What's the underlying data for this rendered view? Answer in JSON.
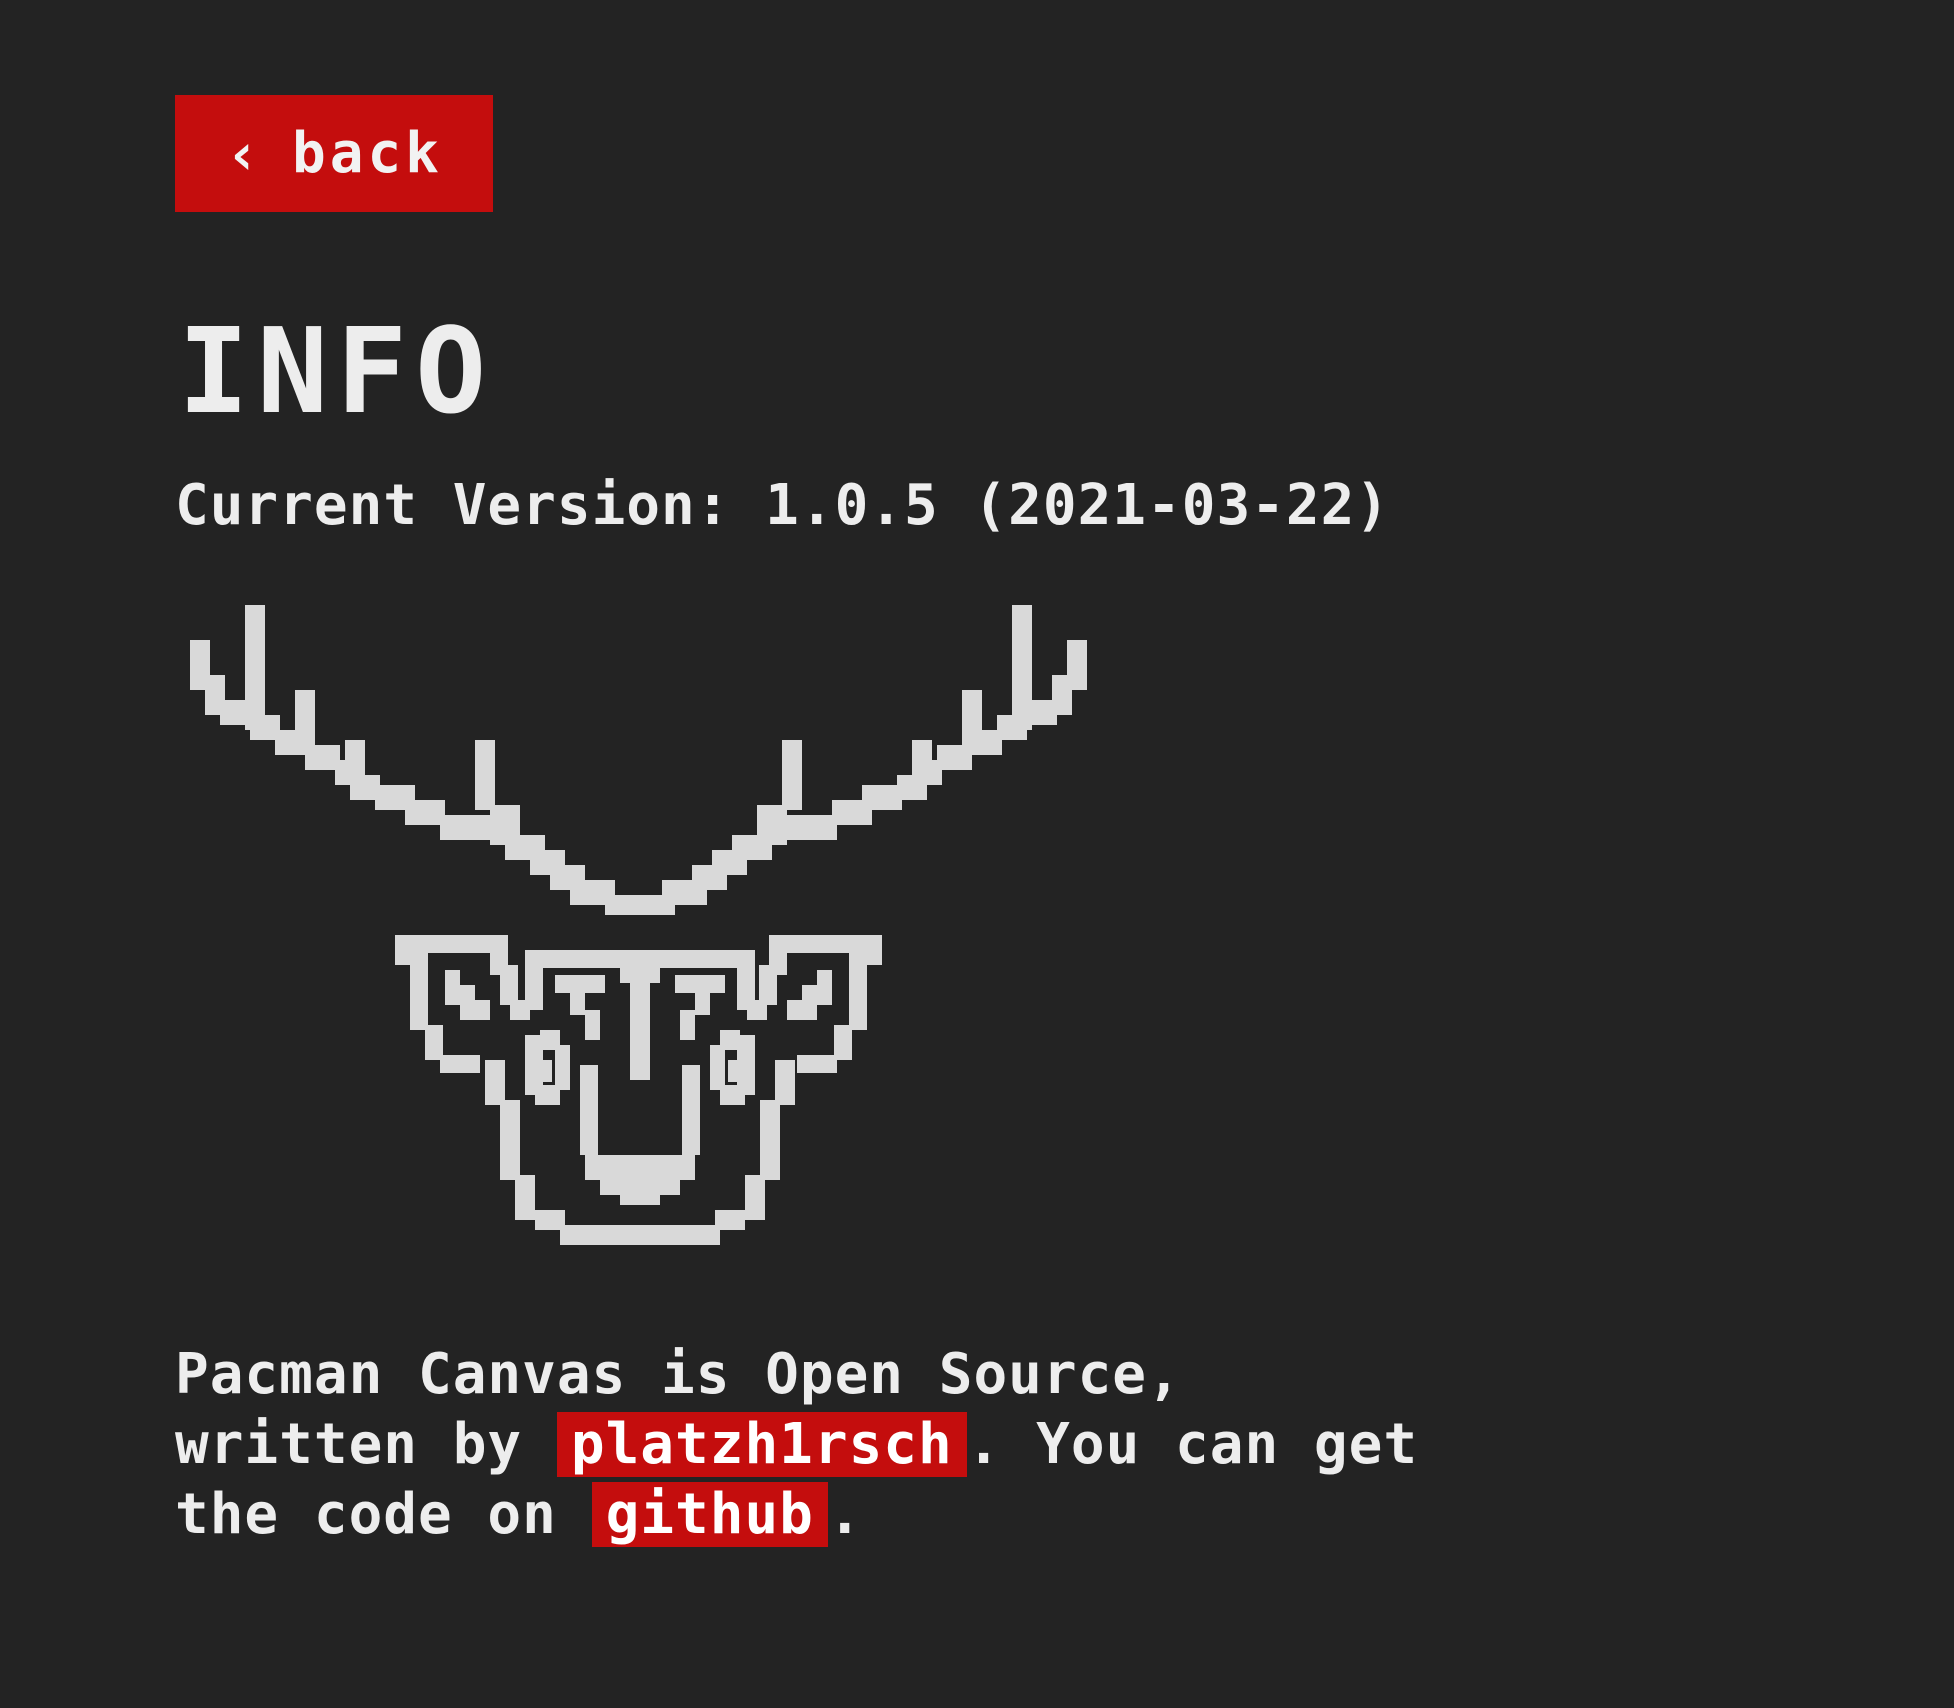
{
  "back_button": {
    "icon": "chevron-left-icon",
    "icon_glyph": "‹",
    "label": "back"
  },
  "page": {
    "title": "INFO",
    "version_label": "Current Version:",
    "version_value": "1.0.5 (2021-03-22)"
  },
  "logo": {
    "icon": "deer-head-logo",
    "color": "#d9d9d9"
  },
  "about": {
    "line1": "Pacman Canvas is Open Source,",
    "line2_prefix": "written by",
    "author_link": "platzh1rsch",
    "line2_suffix": ". You can get",
    "line3_prefix": "the code on",
    "github_link": "github",
    "line3_suffix": "."
  },
  "colors": {
    "background": "#232323",
    "accent": "#c40d0d",
    "text": "#ededed"
  }
}
